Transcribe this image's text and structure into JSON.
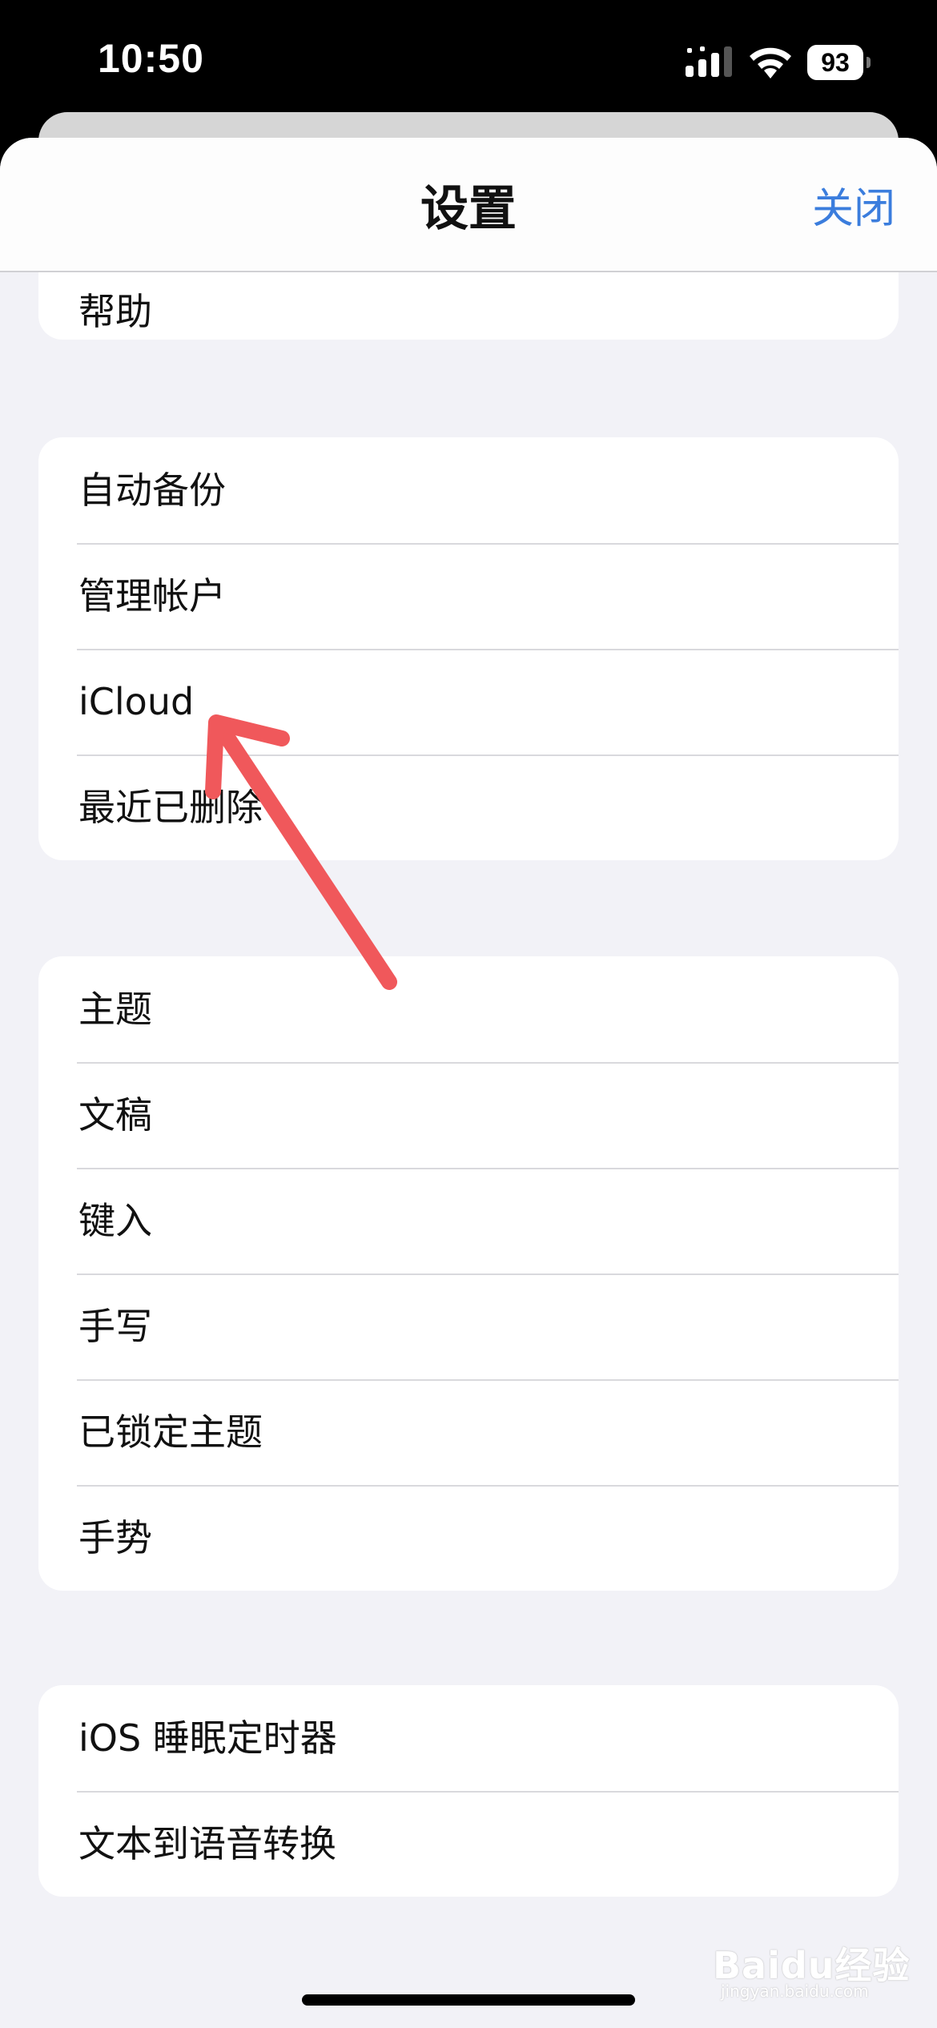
{
  "status_bar": {
    "time": "10:50",
    "battery": "93"
  },
  "nav": {
    "title": "设置",
    "close_label": "关闭"
  },
  "groups": [
    {
      "items": [
        "帮助"
      ]
    },
    {
      "items": [
        "自动备份",
        "管理帐户",
        "iCloud",
        "最近已删除"
      ]
    },
    {
      "items": [
        "主题",
        "文稿",
        "键入",
        "手写",
        "已锁定主题",
        "手势"
      ]
    },
    {
      "items": [
        "iOS 睡眠定时器",
        "文本到语音转换"
      ]
    }
  ],
  "annotation": {
    "type": "arrow",
    "color": "#f0585b",
    "points_to": "iCloud"
  },
  "watermark": {
    "text": "Baidu经验",
    "sub": "jingyan.baidu.com"
  }
}
